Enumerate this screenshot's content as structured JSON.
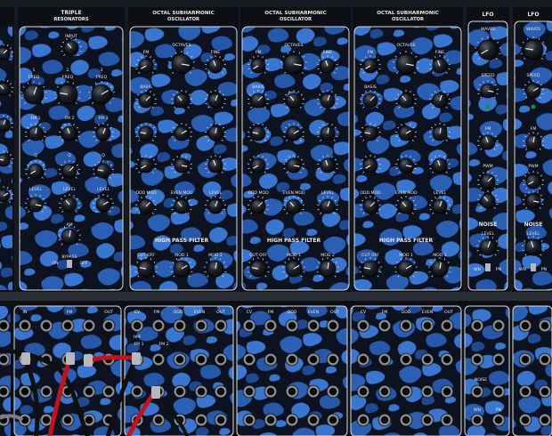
{
  "modules": [
    {
      "title": "TRIPLE",
      "title2": "RESONATORS",
      "labels": [
        "INPUT",
        "1",
        "2",
        "3",
        "FREQ",
        "FREQ",
        "FREQ",
        "FM 1",
        "FM 2",
        "FM 3",
        "Q",
        "Q",
        "Q",
        "LEVEL",
        "LEVEL",
        "LEVEL",
        "AM",
        "BYPASS",
        "ON",
        "OFF"
      ]
    },
    {
      "title": "OCTAL SUBHARMONIC",
      "title2": "OSCILLATOR",
      "labels": [
        "FM",
        "OCTAVES",
        "FINE",
        "BASIS",
        "ODD MOD",
        "EVEN MOD",
        "LEVEL",
        "HIGH PASS FILTER",
        "CUT OFF",
        "MOD 1",
        "MOD 2"
      ]
    },
    {
      "title": "OCTAL SUBHARMONIC",
      "title2": "OSCILLATOR",
      "labels": [
        "FM",
        "OCTAVES",
        "FINE",
        "BASIS",
        "ODD MOD",
        "EVEN MOD",
        "LEVEL",
        "HIGH PASS FILTER",
        "CUT OFF",
        "MOD 1",
        "MOD 2"
      ]
    },
    {
      "title": "OCTAL SUBHARMONIC",
      "title2": "OSCILLATOR",
      "labels": [
        "FM",
        "OCTAVES",
        "FINE",
        "BASIS",
        "ODD MOD",
        "EVEN MOD",
        "LEVEL",
        "HIGH PASS FILTER",
        "CUT OFF",
        "MOD 1",
        "MOD 2"
      ]
    },
    {
      "title": "LFO",
      "labels": [
        "WAVES",
        "SPEED",
        "FM",
        "PWM",
        "NOISE",
        "LEVEL",
        "WN",
        "PN"
      ]
    },
    {
      "title": "LFO",
      "labels": [
        "WAVES",
        "SPEED",
        "FM",
        "PWM",
        "NOISE",
        "LEVEL",
        "WN",
        "PN"
      ]
    }
  ],
  "patch": {
    "labels": [
      "IN",
      "FM",
      "OUT",
      "CV",
      "FM",
      "ODD",
      "EVEN",
      "OUT",
      "HPF",
      "FM 1",
      "FM 2",
      "NOISE",
      "WN",
      "PN"
    ]
  },
  "colors": {
    "panel": "#0d0f14",
    "camo_blue": "#2b5fb4",
    "silk": "#e8e8ec",
    "cable_red": "#c1121f",
    "cable_black": "#101010"
  }
}
